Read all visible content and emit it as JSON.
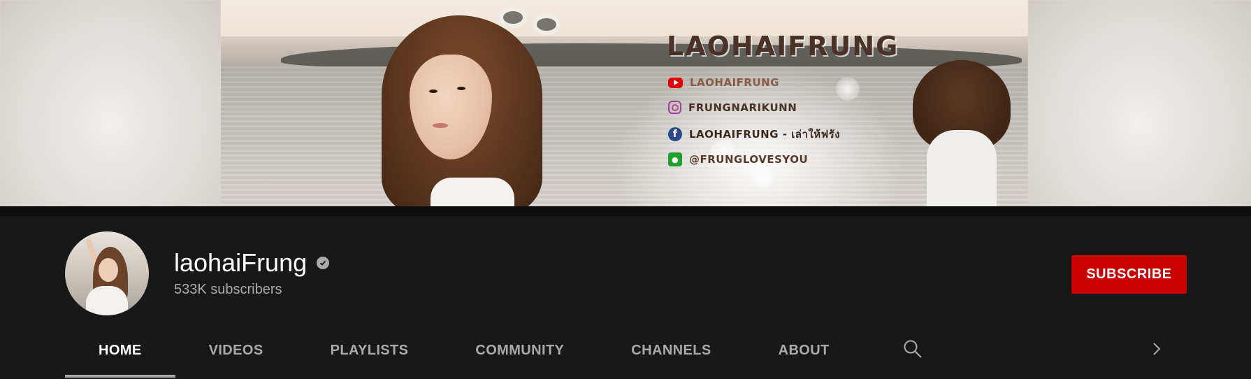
{
  "banner": {
    "title": "LAOHAIFRUNG",
    "socials": [
      {
        "icon": "youtube-icon",
        "text": "LAOHAIFRUNG",
        "color": "#8a5a44"
      },
      {
        "icon": "instagram-icon",
        "text": "FRUNGNARIKUNN",
        "color": "#4a3226"
      },
      {
        "icon": "facebook-icon",
        "text": "LAOHAIFRUNG - เล่าให้ฟรัง",
        "color": "#3a2a22"
      },
      {
        "icon": "line-icon",
        "text": "@FRUNGLOVESYOU",
        "color": "#5a3a2a"
      }
    ]
  },
  "channel": {
    "name": "laohaiFrung",
    "verified_icon": "verified-check-icon",
    "subscribers": "533K subscribers",
    "avatar_icon": "channel-avatar"
  },
  "subscribe": {
    "label": "SUBSCRIBE",
    "color": "#cc0000"
  },
  "tabs": [
    {
      "label": "HOME",
      "active": true
    },
    {
      "label": "VIDEOS",
      "active": false
    },
    {
      "label": "PLAYLISTS",
      "active": false
    },
    {
      "label": "COMMUNITY",
      "active": false
    },
    {
      "label": "CHANNELS",
      "active": false
    },
    {
      "label": "ABOUT",
      "active": false
    }
  ],
  "tab_icons": {
    "search": "search-icon",
    "next": "chevron-right-icon"
  },
  "colors": {
    "page_bg": "#181818",
    "tab_active": "#ffffff",
    "tab_inactive": "#aaaaaa"
  }
}
